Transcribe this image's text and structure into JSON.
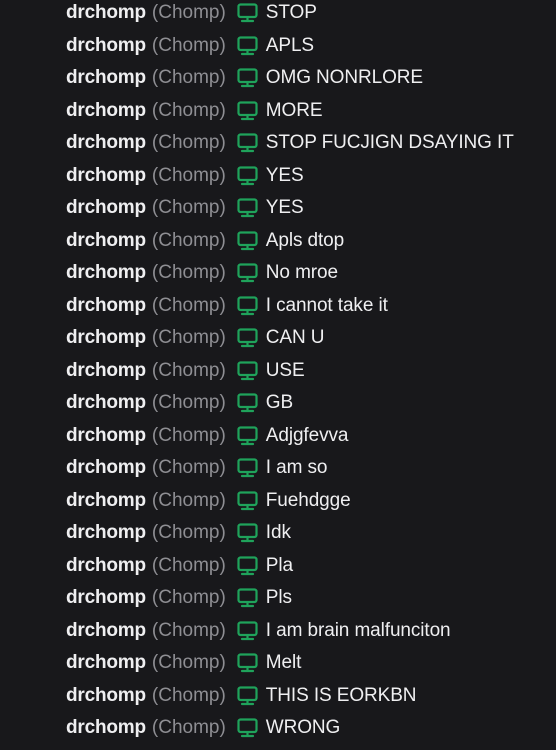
{
  "icon": {
    "name": "desktop-icon",
    "color": "#1fa35b"
  },
  "messages": [
    {
      "user": "drchomp",
      "display": "(Chomp)",
      "text": "STOP"
    },
    {
      "user": "drchomp",
      "display": "(Chomp)",
      "text": "APLS"
    },
    {
      "user": "drchomp",
      "display": "(Chomp)",
      "text": "OMG NONRLORE"
    },
    {
      "user": "drchomp",
      "display": "(Chomp)",
      "text": "MORE"
    },
    {
      "user": "drchomp",
      "display": "(Chomp)",
      "text": "STOP FUCJIGN DSAYING IT"
    },
    {
      "user": "drchomp",
      "display": "(Chomp)",
      "text": "YES"
    },
    {
      "user": "drchomp",
      "display": "(Chomp)",
      "text": "YES"
    },
    {
      "user": "drchomp",
      "display": "(Chomp)",
      "text": "Apls dtop"
    },
    {
      "user": "drchomp",
      "display": "(Chomp)",
      "text": "No mroe"
    },
    {
      "user": "drchomp",
      "display": "(Chomp)",
      "text": "I cannot take it"
    },
    {
      "user": "drchomp",
      "display": "(Chomp)",
      "text": "CAN U"
    },
    {
      "user": "drchomp",
      "display": "(Chomp)",
      "text": "USE"
    },
    {
      "user": "drchomp",
      "display": "(Chomp)",
      "text": "GB"
    },
    {
      "user": "drchomp",
      "display": "(Chomp)",
      "text": "Adjgfevva"
    },
    {
      "user": "drchomp",
      "display": "(Chomp)",
      "text": "I am so"
    },
    {
      "user": "drchomp",
      "display": "(Chomp)",
      "text": "Fuehdgge"
    },
    {
      "user": "drchomp",
      "display": "(Chomp)",
      "text": "Idk"
    },
    {
      "user": "drchomp",
      "display": "(Chomp)",
      "text": "Pla"
    },
    {
      "user": "drchomp",
      "display": "(Chomp)",
      "text": "Pls"
    },
    {
      "user": "drchomp",
      "display": "(Chomp)",
      "text": "I am brain malfunciton"
    },
    {
      "user": "drchomp",
      "display": "(Chomp)",
      "text": "Melt"
    },
    {
      "user": "drchomp",
      "display": "(Chomp)",
      "text": "THIS IS EORKBN"
    },
    {
      "user": "drchomp",
      "display": "(Chomp)",
      "text": "WRONG"
    }
  ]
}
